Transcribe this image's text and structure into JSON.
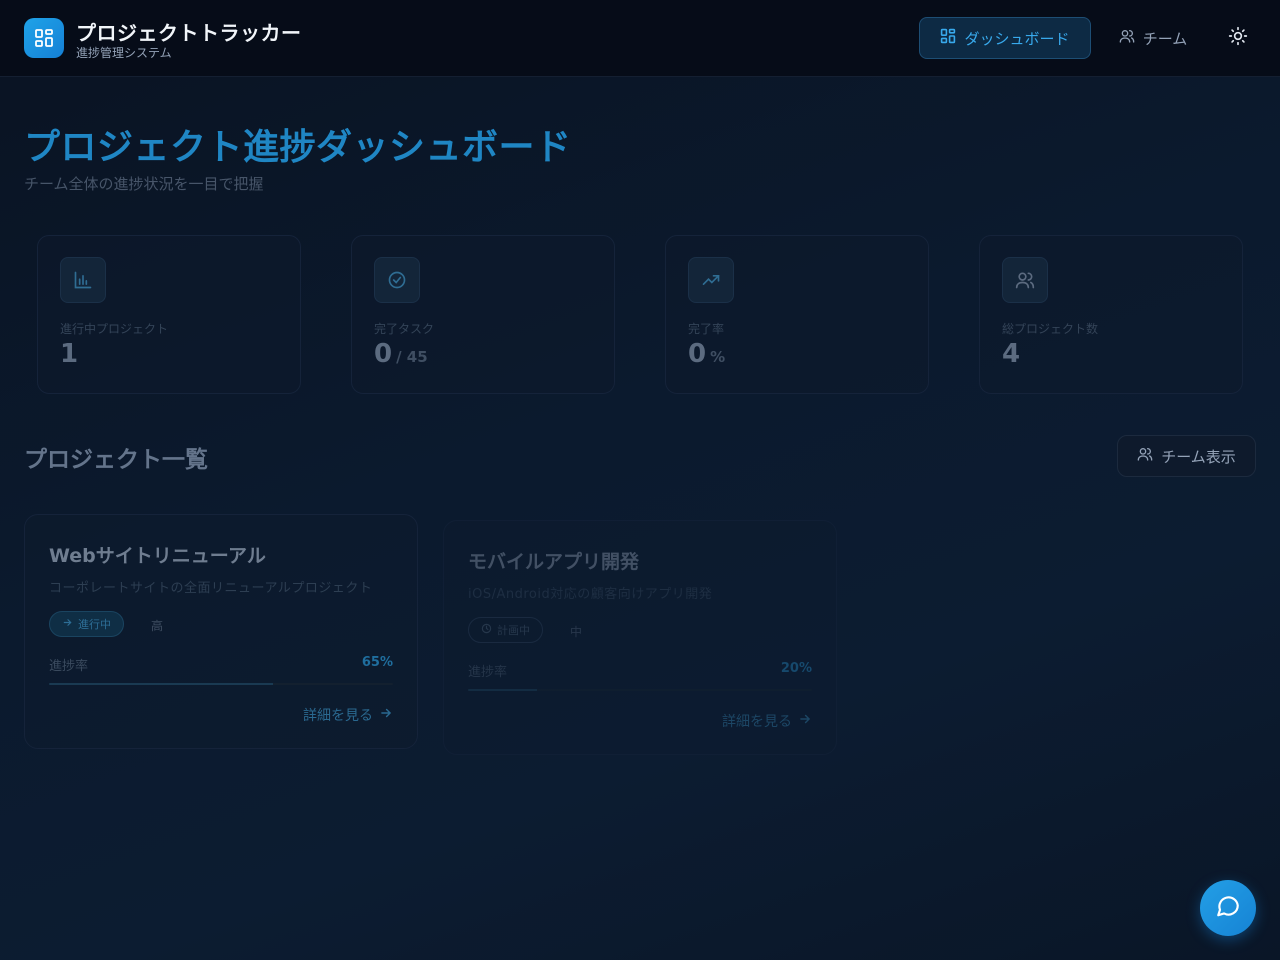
{
  "header": {
    "app_title": "プロジェクトトラッカー",
    "app_subtitle": "進捗管理システム",
    "nav": {
      "dashboard_label": "ダッシュボード",
      "team_label": "チーム"
    },
    "icons": {
      "logo": "grid-icon",
      "theme": "sun-icon"
    }
  },
  "page": {
    "title": "プロジェクト進捗ダッシュボード",
    "subtitle": "チーム全体の進捗状況を一目で把握"
  },
  "stats": [
    {
      "label": "進行中プロジェクト",
      "value": "1",
      "unit": "",
      "icon": "bar-chart-icon"
    },
    {
      "label": "完了タスク",
      "value": "0",
      "unit": "/ 45",
      "icon": "check-circle-icon"
    },
    {
      "label": "完了率",
      "value": "0",
      "unit": "%",
      "icon": "trending-up-icon"
    },
    {
      "label": "総プロジェクト数",
      "value": "4",
      "unit": "",
      "icon": "users-icon"
    }
  ],
  "projects_section": {
    "title": "プロジェクト一覧",
    "team_view_label": "チーム表示"
  },
  "projects": [
    {
      "name": "Webサイトリニューアル",
      "description": "コーポレートサイトの全面リニューアルプロジェクト",
      "status": "進行中",
      "priority": "高",
      "progress_label": "進捗率",
      "progress_text": "65%",
      "progress": 0.65,
      "detail_label": "詳細を見る"
    },
    {
      "name": "モバイルアプリ開発",
      "description": "iOS/Android対応の顧客向けアプリ開発",
      "status": "計画中",
      "priority": "中",
      "progress_label": "進捗率",
      "progress_text": "20%",
      "progress": 0.2,
      "detail_label": "詳細を見る"
    }
  ],
  "colors": {
    "accent": "#1f9fe8",
    "background": "#0b1a2e",
    "header_bg": "#060c18"
  }
}
